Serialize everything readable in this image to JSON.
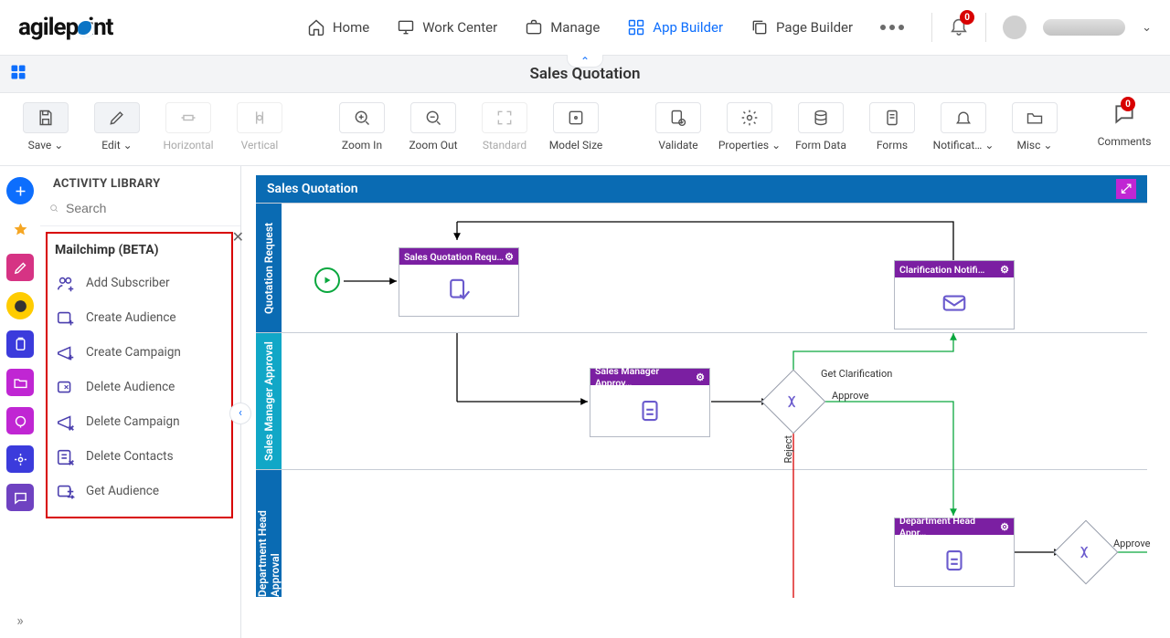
{
  "nav": {
    "home": "Home",
    "work_center": "Work Center",
    "manage": "Manage",
    "app_builder": "App Builder",
    "page_builder": "Page Builder",
    "notif_count": "0"
  },
  "title": "Sales Quotation",
  "toolbar": {
    "save": "Save",
    "edit": "Edit",
    "horizontal": "Horizontal",
    "vertical": "Vertical",
    "zoom_in": "Zoom In",
    "zoom_out": "Zoom Out",
    "standard": "Standard",
    "model_size": "Model Size",
    "validate": "Validate",
    "properties": "Properties",
    "form_data": "Form Data",
    "forms": "Forms",
    "notifications": "Notificat…",
    "misc": "Misc",
    "comments": "Comments",
    "comments_count": "0"
  },
  "library": {
    "header": "ACTIVITY LIBRARY",
    "search_placeholder": "Search",
    "group_title": "Mailchimp (BETA)",
    "items": {
      "add_subscriber": "Add Subscriber",
      "create_audience": "Create Audience",
      "create_campaign": "Create Campaign",
      "delete_audience": "Delete Audience",
      "delete_campaign": "Delete Campaign",
      "delete_contacts": "Delete Contacts",
      "get_audience": "Get Audience"
    }
  },
  "workflow": {
    "title": "Sales Quotation",
    "lanes": {
      "l1": "Quotation Request",
      "l2": "Sales Manager Approval",
      "l3": "Department Head Approval"
    },
    "nodes": {
      "quote_req": "Sales Quotation Requ…",
      "clarif": "Clarification Notifi…",
      "mgr_approv": "Sales Manager Approv…",
      "dept_approv": "Department Head Appr…"
    },
    "labels": {
      "get_clar": "Get Clarification",
      "approve": "Approve",
      "reject": "Reject",
      "approve2": "Approve"
    }
  }
}
